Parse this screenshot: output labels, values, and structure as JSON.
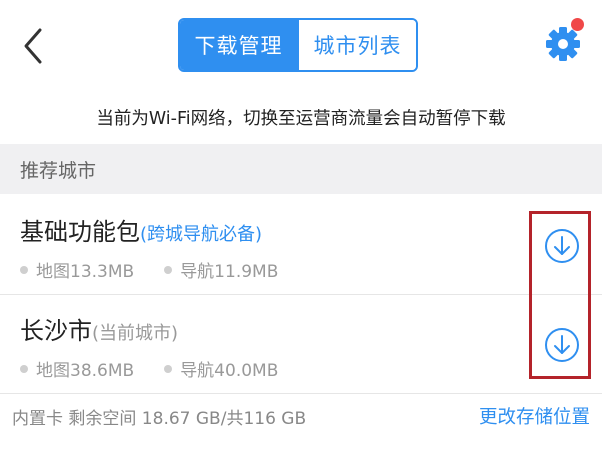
{
  "header": {
    "tabs": [
      {
        "label": "下载管理",
        "active": true
      },
      {
        "label": "城市列表",
        "active": false
      }
    ],
    "icons": {
      "back": "chevron-left-icon",
      "settings": "gear-icon",
      "notification": "red-dot-badge"
    },
    "colors": {
      "accent": "#2f8ff0",
      "badge": "#f04848"
    }
  },
  "notice": "当前为Wi-Fi网络，切换至运营商流量会自动暂停下载",
  "section": {
    "title": "推荐城市"
  },
  "cities": [
    {
      "name": "基础功能包",
      "tag": "(跨城导航必备)",
      "map_size": "地图13.3MB",
      "nav_size": "导航11.9MB",
      "action_icon": "download-icon"
    },
    {
      "name": "长沙市",
      "tag": "(当前城市)",
      "map_size": "地图38.6MB",
      "nav_size": "导航40.0MB",
      "action_icon": "download-icon"
    }
  ],
  "highlight_color": "#b4232a",
  "footer": {
    "storage_info": "内置卡 剩余空间 18.67 GB/共116 GB",
    "change_storage": "更改存储位置"
  }
}
